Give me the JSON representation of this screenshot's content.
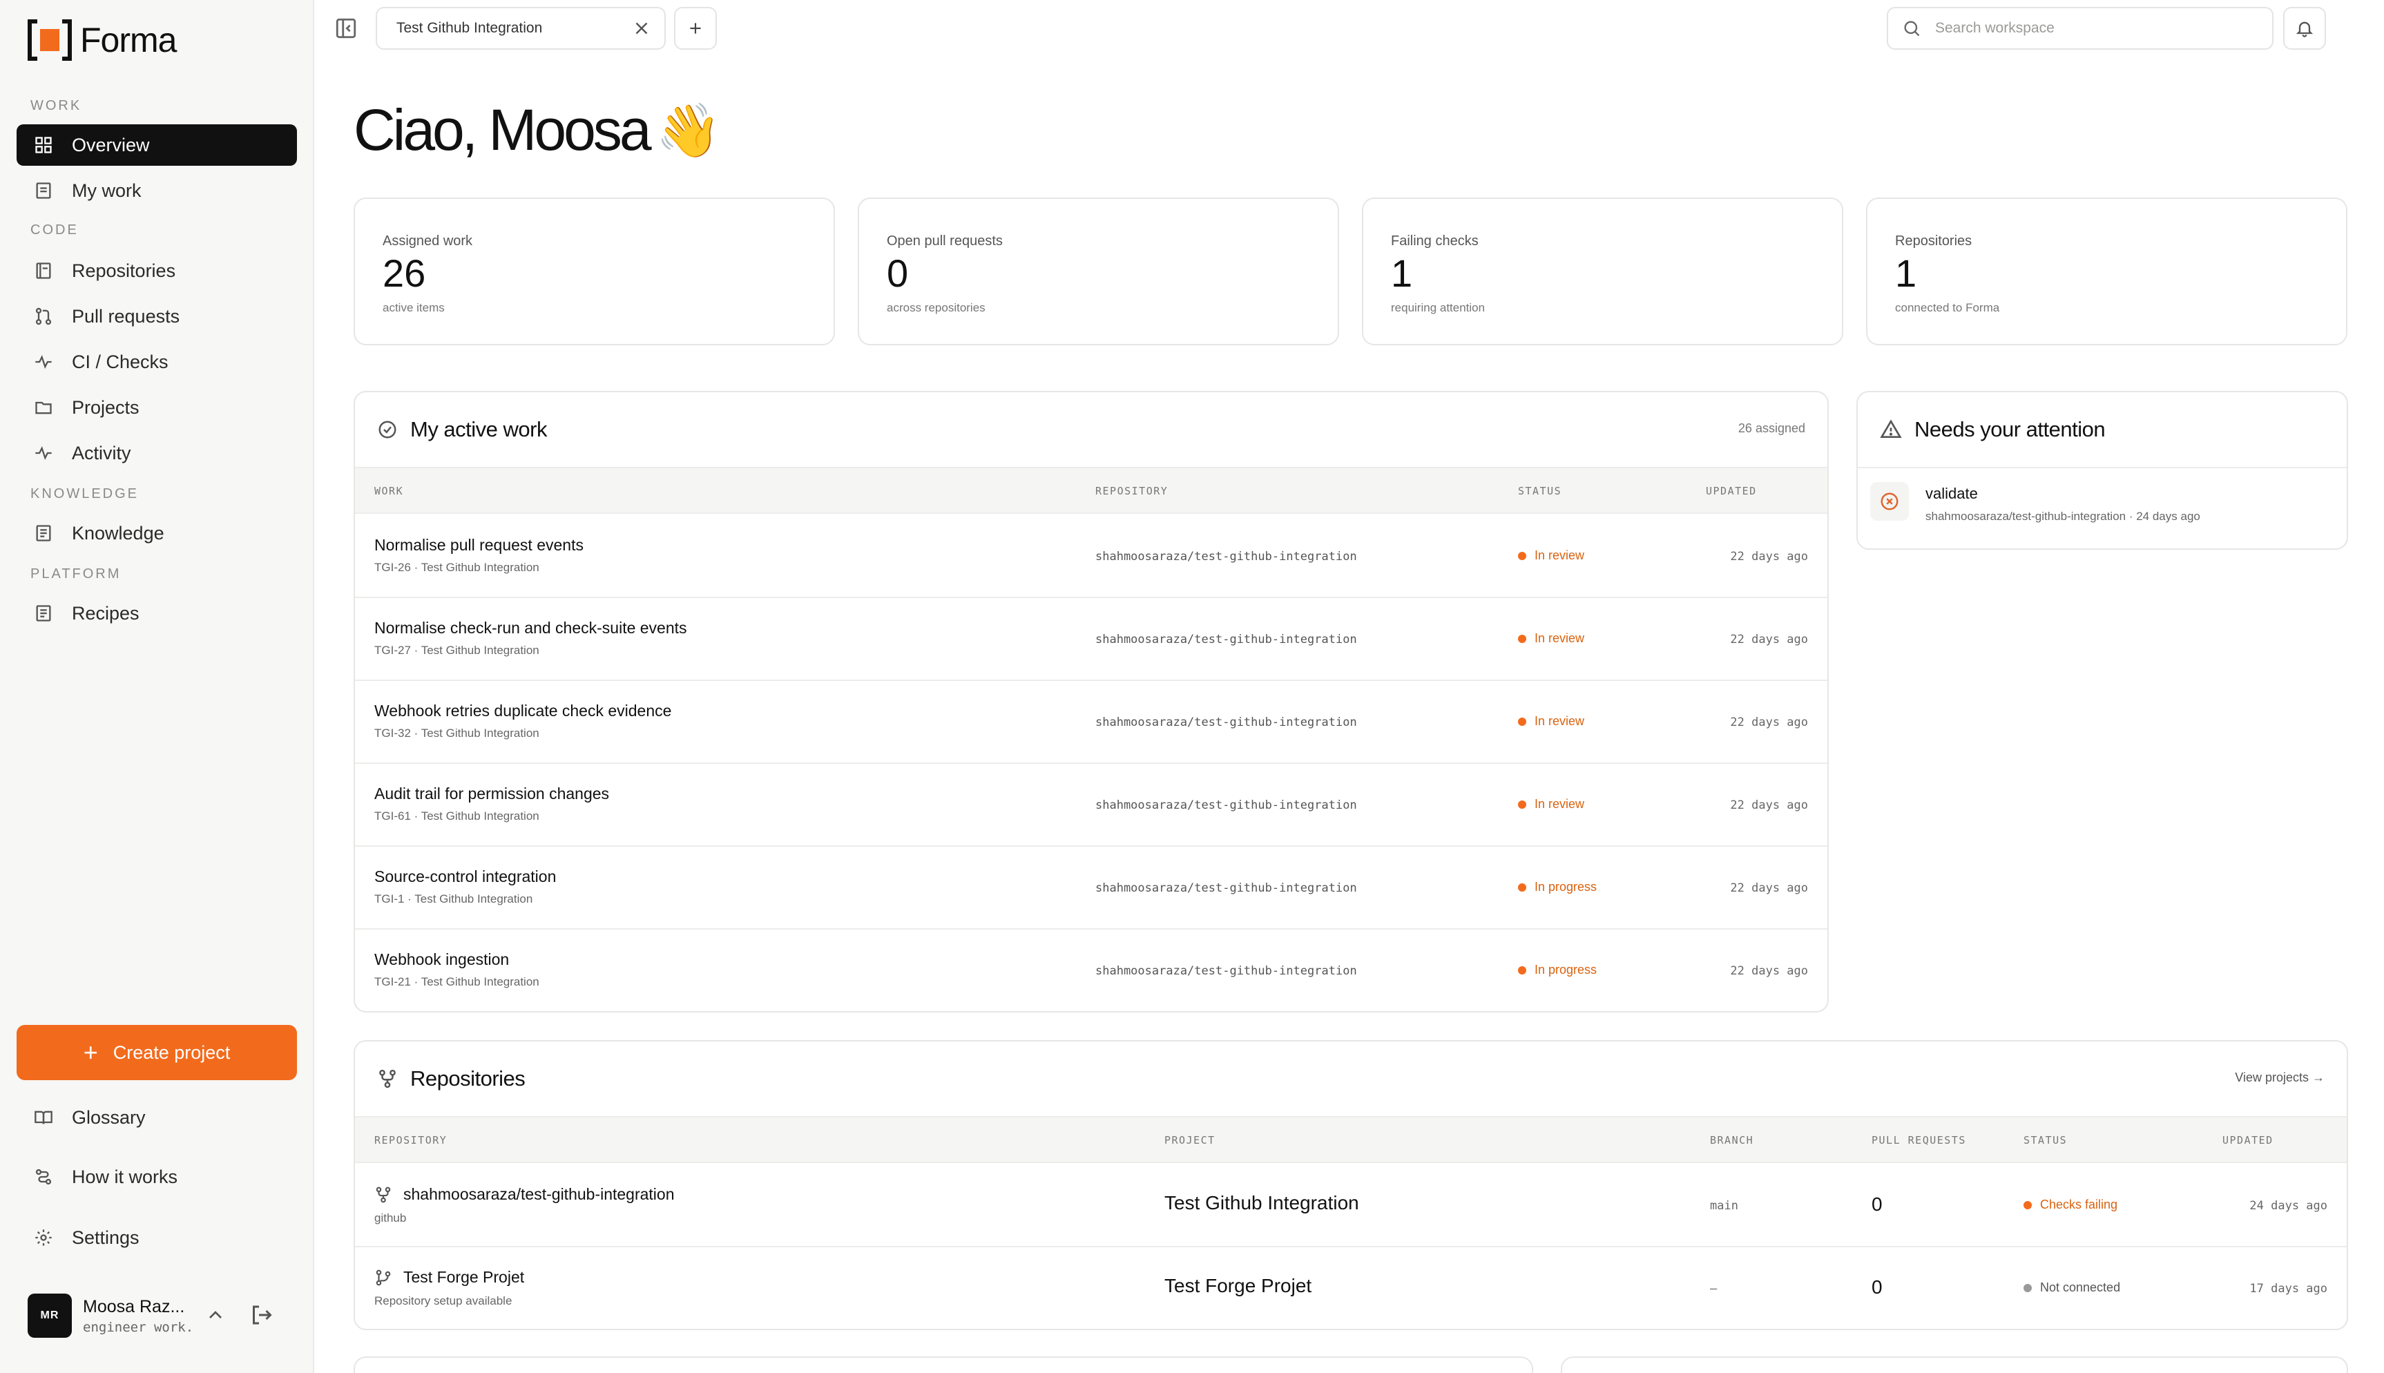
{
  "brand": {
    "name": "Forma",
    "accent": "#f26b1d"
  },
  "sidebar": {
    "sections": {
      "work": "WORK",
      "code": "CODE",
      "knowledge": "KNOWLEDGE",
      "platform": "PLATFORM"
    },
    "items": {
      "overview": {
        "label": "Overview",
        "icon": "grid-icon",
        "active": true
      },
      "my_work": {
        "label": "My work",
        "icon": "list-icon"
      },
      "repositories": {
        "label": "Repositories",
        "icon": "book-icon"
      },
      "pull_requests": {
        "label": "Pull requests",
        "icon": "git-pull-request-icon"
      },
      "ci_checks": {
        "label": "CI / Checks",
        "icon": "pulse-icon"
      },
      "projects": {
        "label": "Projects",
        "icon": "folder-icon"
      },
      "activity": {
        "label": "Activity",
        "icon": "activity-icon"
      },
      "knowledge": {
        "label": "Knowledge",
        "icon": "document-icon"
      },
      "recipes": {
        "label": "Recipes",
        "icon": "document-icon"
      }
    },
    "create_project": "Create project",
    "footer": {
      "glossary": "Glossary",
      "how_it_works": "How it works",
      "settings": "Settings"
    },
    "user": {
      "initials": "MR",
      "name": "Moosa Raz...",
      "role": "engineer work..."
    }
  },
  "topbar": {
    "tab_title": "Test Github Integration",
    "search_placeholder": "Search workspace"
  },
  "greeting": {
    "text": "Ciao, Moosa",
    "emoji": "👋"
  },
  "stats": [
    {
      "label": "Assigned work",
      "value": "26",
      "sub": "active items"
    },
    {
      "label": "Open pull requests",
      "value": "0",
      "sub": "across repositories"
    },
    {
      "label": "Failing checks",
      "value": "1",
      "sub": "requiring attention"
    },
    {
      "label": "Repositories",
      "value": "1",
      "sub": "connected to Forma"
    }
  ],
  "active_work": {
    "title": "My active work",
    "meta": "26 assigned",
    "columns": {
      "work": "WORK",
      "repository": "REPOSITORY",
      "status": "STATUS",
      "updated": "UPDATED"
    },
    "rows": [
      {
        "title": "Normalise pull request events",
        "sub": "TGI-26 · Test Github Integration",
        "repo": "shahmoosaraza/test-github-integration",
        "status": "In review",
        "updated": "22 days ago"
      },
      {
        "title": "Normalise check-run and check-suite events",
        "sub": "TGI-27 · Test Github Integration",
        "repo": "shahmoosaraza/test-github-integration",
        "status": "In review",
        "updated": "22 days ago"
      },
      {
        "title": "Webhook retries duplicate check evidence",
        "sub": "TGI-32 · Test Github Integration",
        "repo": "shahmoosaraza/test-github-integration",
        "status": "In review",
        "updated": "22 days ago"
      },
      {
        "title": "Audit trail for permission changes",
        "sub": "TGI-61 · Test Github Integration",
        "repo": "shahmoosaraza/test-github-integration",
        "status": "In review",
        "updated": "22 days ago"
      },
      {
        "title": "Source-control integration",
        "sub": "TGI-1 · Test Github Integration",
        "repo": "shahmoosaraza/test-github-integration",
        "status": "In progress",
        "updated": "22 days ago"
      },
      {
        "title": "Webhook ingestion",
        "sub": "TGI-21 · Test Github Integration",
        "repo": "shahmoosaraza/test-github-integration",
        "status": "In progress",
        "updated": "22 days ago"
      }
    ]
  },
  "attention": {
    "title": "Needs your attention",
    "items": [
      {
        "title": "validate",
        "sub": "shahmoosaraza/test-github-integration · 24 days ago"
      }
    ]
  },
  "repositories": {
    "title": "Repositories",
    "link": "View projects →",
    "columns": {
      "repository": "REPOSITORY",
      "project": "PROJECT",
      "branch": "BRANCH",
      "pull_requests": "PULL REQUESTS",
      "status": "STATUS",
      "updated": "UPDATED"
    },
    "rows": [
      {
        "name": "shahmoosaraza/test-github-integration",
        "host": "github",
        "project": "Test Github Integration",
        "branch": "main",
        "prs": "0",
        "status": "Checks failing",
        "updated": "24 days ago"
      },
      {
        "name": "Test Forge Projet",
        "host": "Repository setup available",
        "project": "Test Forge Projet",
        "branch": "–",
        "prs": "0",
        "status": "Not connected",
        "updated": "17 days ago"
      }
    ]
  }
}
